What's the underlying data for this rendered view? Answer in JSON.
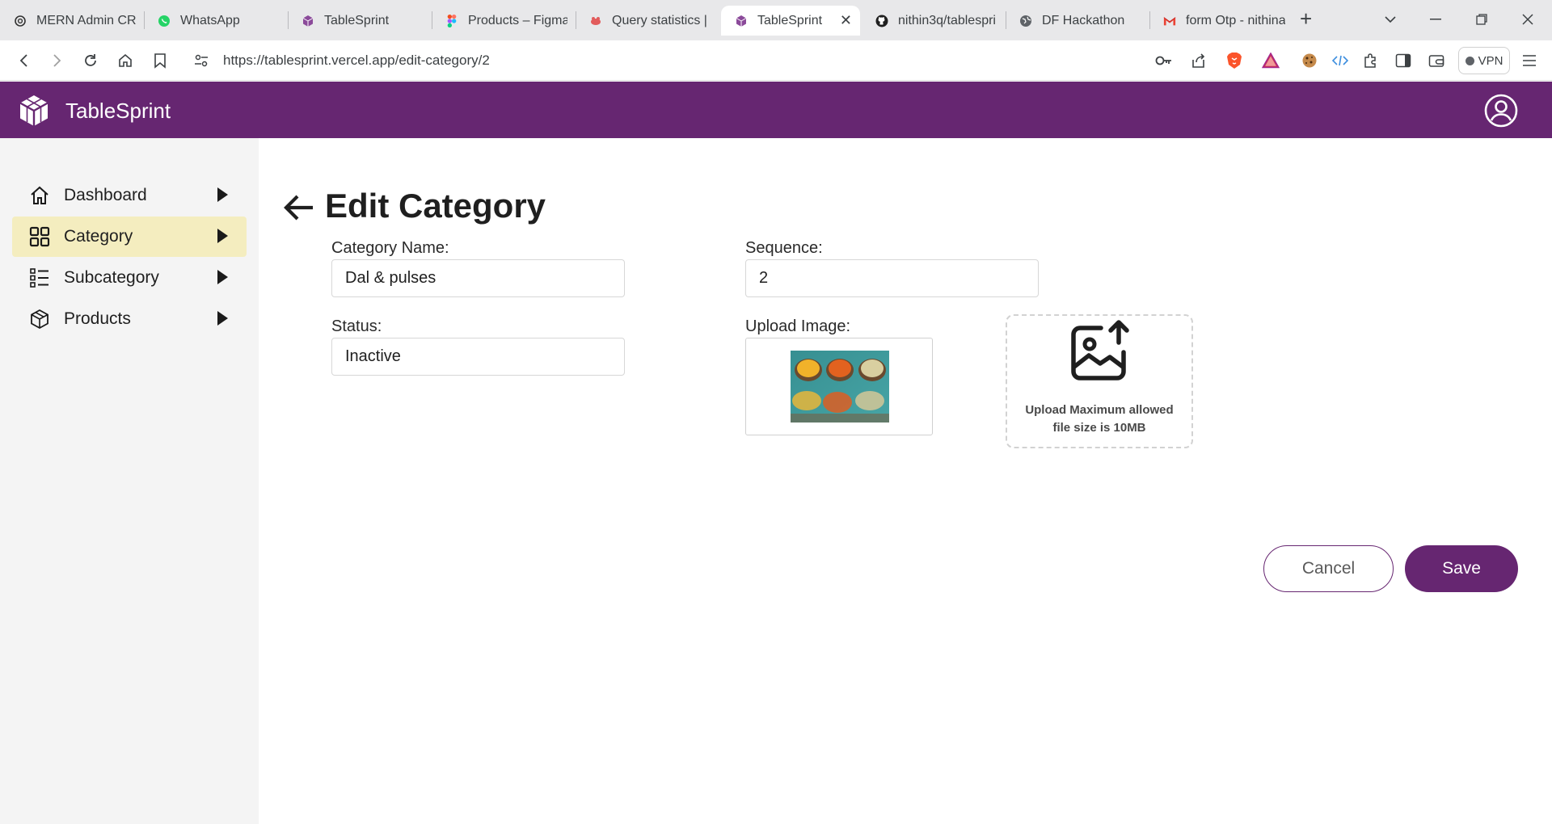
{
  "browser": {
    "tabs": [
      {
        "title": "MERN Admin CRU",
        "icon": "chatgpt-icon"
      },
      {
        "title": "WhatsApp",
        "icon": "whatsapp-icon"
      },
      {
        "title": "TableSprint",
        "icon": "tablesprint-icon"
      },
      {
        "title": "Products – Figma",
        "icon": "figma-icon"
      },
      {
        "title": "Query statistics | r",
        "icon": "supabase-icon"
      },
      {
        "title": "TableSprint",
        "icon": "tablesprint-icon",
        "active": true
      },
      {
        "title": "nithin3q/tablespri",
        "icon": "github-icon"
      },
      {
        "title": "DF Hackathon",
        "icon": "globe-icon"
      },
      {
        "title": "form Otp - nithina",
        "icon": "gmail-icon"
      }
    ],
    "url": "https://tablesprint.vercel.app/edit-category/2",
    "vpn_label": "VPN"
  },
  "app": {
    "brand": "TableSprint",
    "accent": "#662671",
    "active_nav_bg": "#f4edbf"
  },
  "sidebar": {
    "items": [
      {
        "label": "Dashboard",
        "icon": "home-icon"
      },
      {
        "label": "Category",
        "icon": "grid-icon",
        "active": true
      },
      {
        "label": "Subcategory",
        "icon": "list-icon"
      },
      {
        "label": "Products",
        "icon": "box-icon"
      }
    ]
  },
  "page": {
    "title": "Edit Category",
    "form": {
      "category_name_label": "Category Name:",
      "category_name_value": "Dal & pulses",
      "sequence_label": "Sequence:",
      "sequence_value": "2",
      "status_label": "Status:",
      "status_value": "Inactive",
      "upload_label": "Upload Image:",
      "upload_hint": "Upload Maximum allowed file size is 10MB"
    },
    "actions": {
      "cancel": "Cancel",
      "save": "Save"
    }
  }
}
